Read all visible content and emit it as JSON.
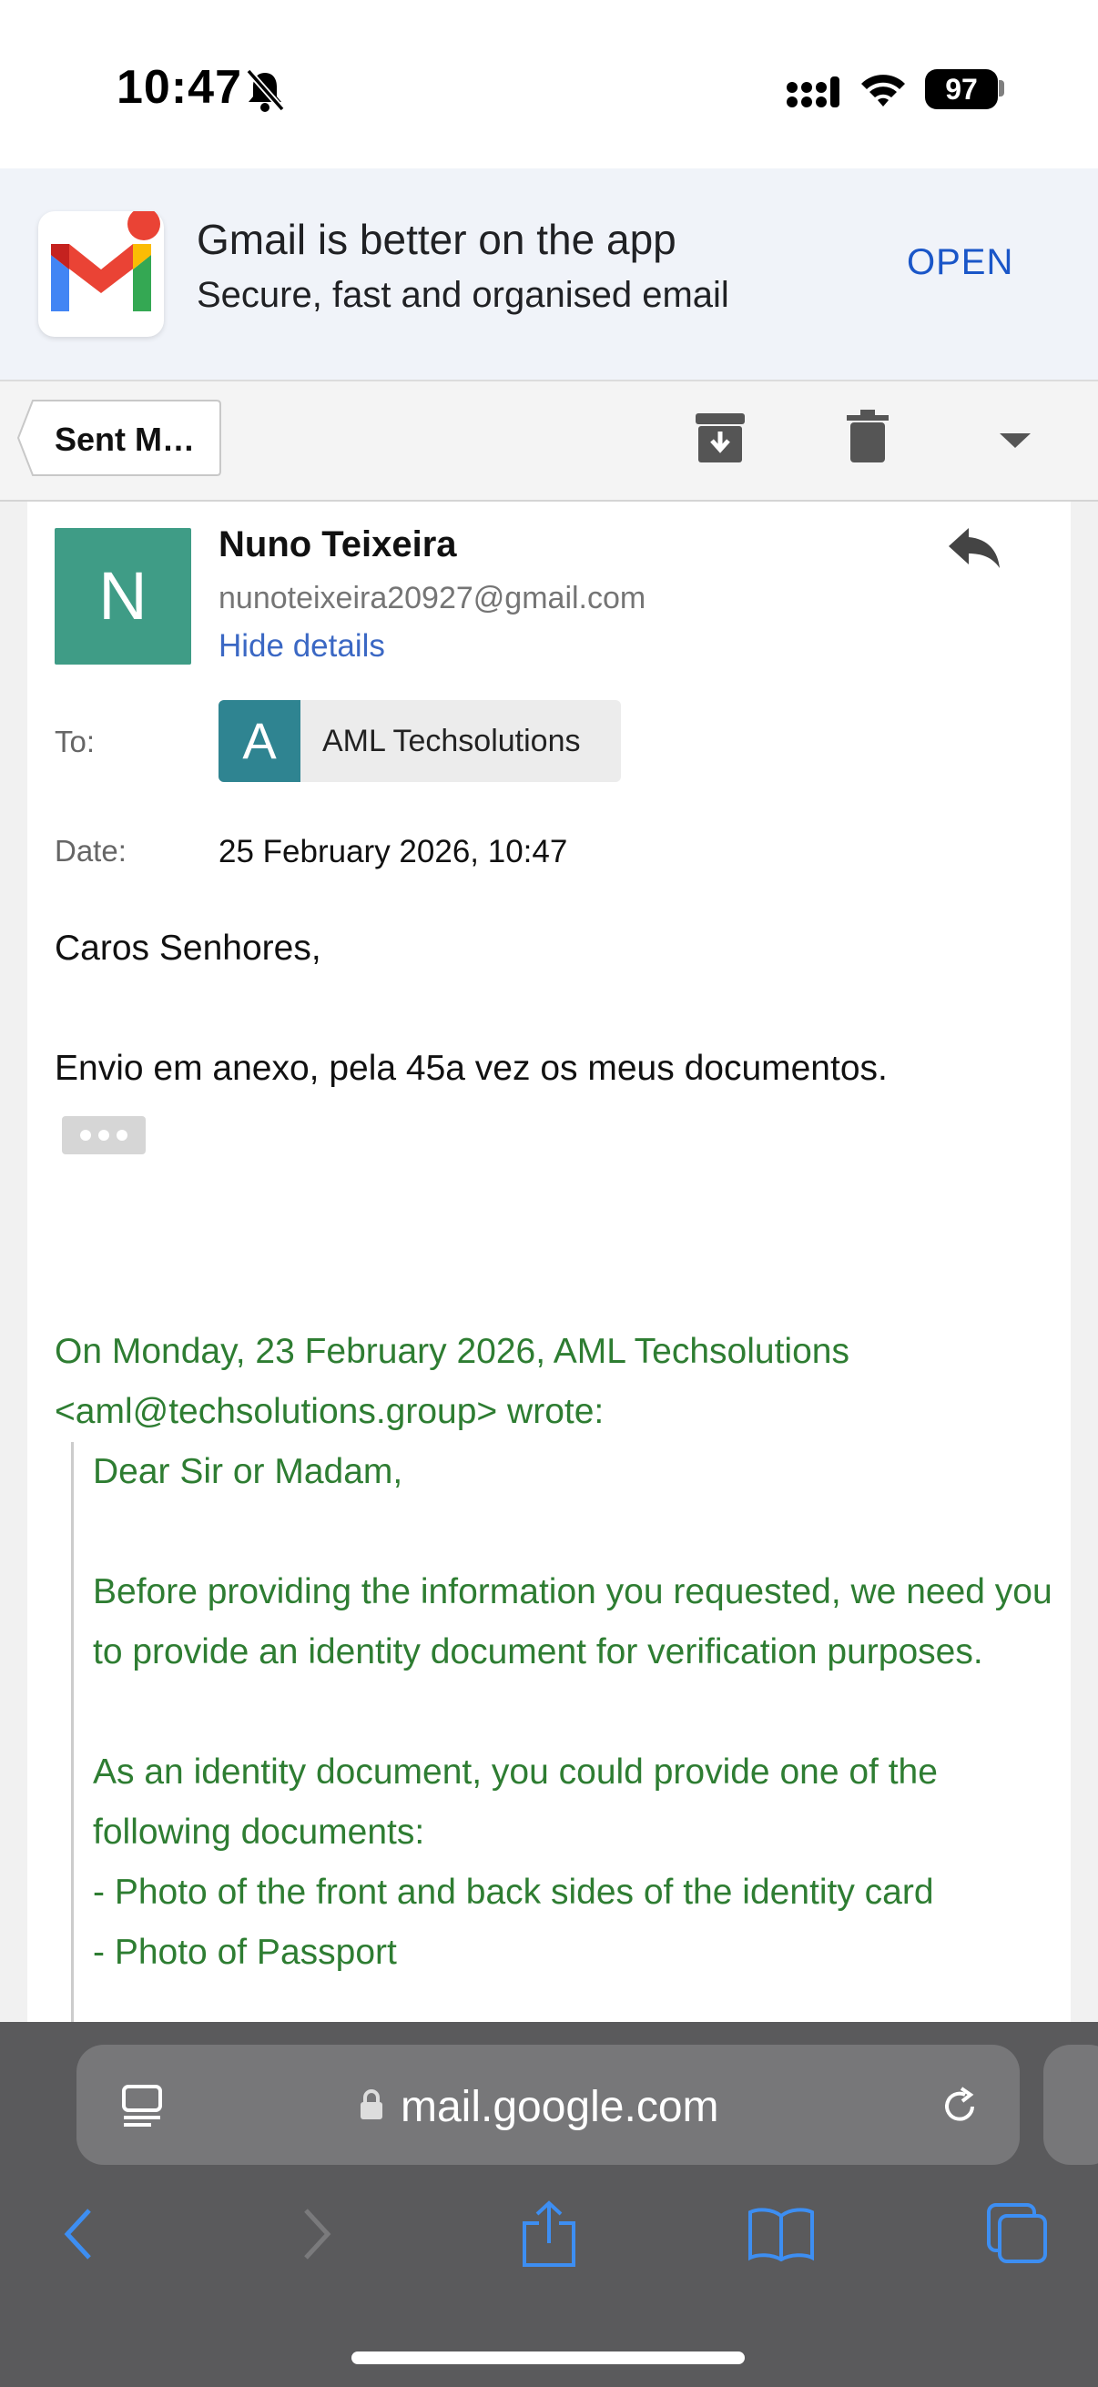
{
  "status_bar": {
    "time": "10:47",
    "battery": "97"
  },
  "app_banner": {
    "title": "Gmail is better on the app",
    "subtitle": "Secure, fast and organised email",
    "open_label": "OPEN"
  },
  "toolbar": {
    "back_label": "Sent M…"
  },
  "email": {
    "sender_initial": "N",
    "sender_name": "Nuno Teixeira",
    "sender_email": "nunoteixeira20927@gmail.com",
    "hide_details_label": "Hide details",
    "to_label": "To:",
    "recipient_initial": "A",
    "recipient_name": "AML Techsolutions",
    "date_label": "Date:",
    "date_value": "25 February 2026, 10:47",
    "greeting": "Caros Senhores,",
    "body": "Envio em anexo, pela 45a vez os meus documentos.",
    "quote_header": "On Monday, 23 February 2026, AML Techsolutions <aml@techsolutions.group> wrote:",
    "quote_body": "Dear Sir or Madam,\n\nBefore providing the information you requested, we need you to provide an identity document for verification purposes.\n\nAs an identity document, you could provide one of the following documents:\n- Photo of the front and back sides of the  identity card\n- Photo of Passport"
  },
  "safari": {
    "url": "mail.google.com"
  },
  "colors": {
    "banner_bg": "#f0f3f9",
    "open_blue": "#1a56c8",
    "sender_avatar": "#3f9c86",
    "recipient_avatar": "#2f8491",
    "quote_green": "#2e7d32",
    "safari_bar": "#5a5a5c",
    "safari_icon_blue": "#3d8ef2"
  }
}
